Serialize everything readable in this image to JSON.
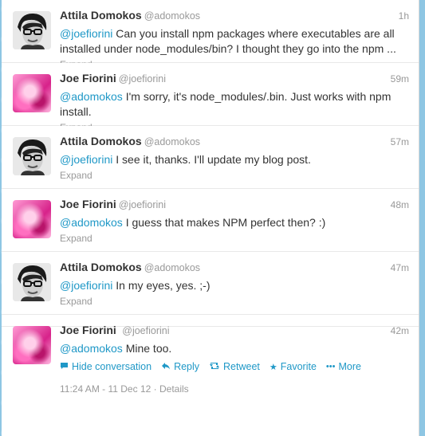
{
  "tweets": [
    {
      "name": "Attila Domokos",
      "handle": "@adomokos",
      "time": "1h",
      "mention": "@joefiorini",
      "text": " Can you install npm packages where executables are all installed under node_modules/bin? I thought they go into the npm ...",
      "expand": "Expand",
      "avatar": "attila"
    },
    {
      "name": "Joe Fiorini",
      "handle": "@joefiorini",
      "time": "59m",
      "mention": "@adomokos",
      "text": " I'm sorry, it's node_modules/.bin. Just works with npm install.",
      "expand": "Expand",
      "avatar": "joe"
    },
    {
      "name": "Attila Domokos",
      "handle": "@adomokos",
      "time": "57m",
      "mention": "@joefiorini",
      "text": " I see it, thanks. I'll update my blog post.",
      "expand": "Expand",
      "avatar": "attila"
    },
    {
      "name": "Joe Fiorini",
      "handle": "@joefiorini",
      "time": "48m",
      "mention": "@adomokos",
      "text": " I guess that makes NPM perfect then? :)",
      "expand": "Expand",
      "avatar": "joe"
    },
    {
      "name": "Attila Domokos",
      "handle": "@adomokos",
      "time": "47m",
      "mention": "@joefiorini",
      "text": " In my eyes, yes. ;-)",
      "expand": "Expand",
      "avatar": "attila"
    }
  ],
  "open_tweet": {
    "name": "Joe Fiorini",
    "handle": "@joefiorini",
    "time": "42m",
    "mention": "@adomokos",
    "text": " Mine too.",
    "actions": {
      "hide": "Hide conversation",
      "reply": "Reply",
      "retweet": "Retweet",
      "favorite": "Favorite",
      "more": "More"
    },
    "timestamp": "11:24 AM - 11 Dec 12",
    "details": "Details"
  },
  "icons": {
    "hide": "speech-bubble-icon",
    "reply": "reply-arrow-icon",
    "retweet": "retweet-icon",
    "favorite": "star-icon",
    "more": "more-dots-icon"
  },
  "colors": {
    "link": "#1f98c7",
    "text": "#333333",
    "muted": "#999999",
    "background": "#8ec6e3"
  }
}
